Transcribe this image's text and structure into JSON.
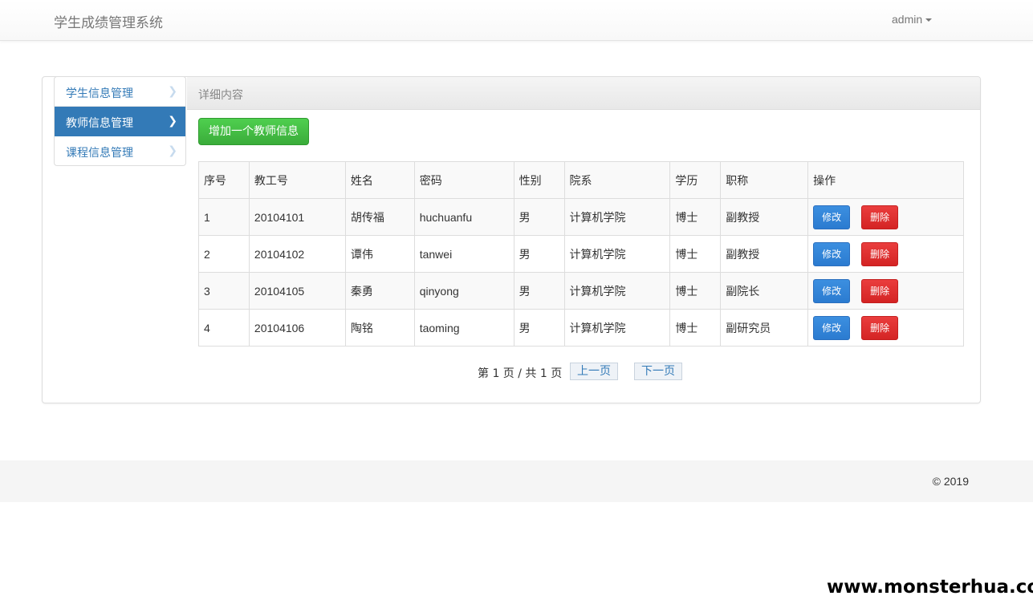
{
  "navbar": {
    "brand": "学生成绩管理系统",
    "user": "admin"
  },
  "sidebar": {
    "items": [
      {
        "label": "学生信息管理",
        "active": false
      },
      {
        "label": "教师信息管理",
        "active": true
      },
      {
        "label": "课程信息管理",
        "active": false
      }
    ]
  },
  "panel": {
    "title": "详细内容",
    "add_button": "增加一个教师信息"
  },
  "table": {
    "headers": [
      "序号",
      "教工号",
      "姓名",
      "密码",
      "性别",
      "院系",
      "学历",
      "职称",
      "操作"
    ],
    "rows": [
      [
        "1",
        "20104101",
        "胡传福",
        "huchuanfu",
        "男",
        "计算机学院",
        "博士",
        "副教授"
      ],
      [
        "2",
        "20104102",
        "谭伟",
        "tanwei",
        "男",
        "计算机学院",
        "博士",
        "副教授"
      ],
      [
        "3",
        "20104105",
        "秦勇",
        "qinyong",
        "男",
        "计算机学院",
        "博士",
        "副院长"
      ],
      [
        "4",
        "20104106",
        "陶铭",
        "taoming",
        "男",
        "计算机学院",
        "博士",
        "副研究员"
      ]
    ],
    "edit_label": "修改",
    "delete_label": "删除"
  },
  "pagination": {
    "info": "第 1 页 / 共 1 页",
    "prev": "上一页",
    "next": "下一页"
  },
  "footer": {
    "copyright": "© 2019"
  },
  "watermark": "www.monsterhua.com"
}
